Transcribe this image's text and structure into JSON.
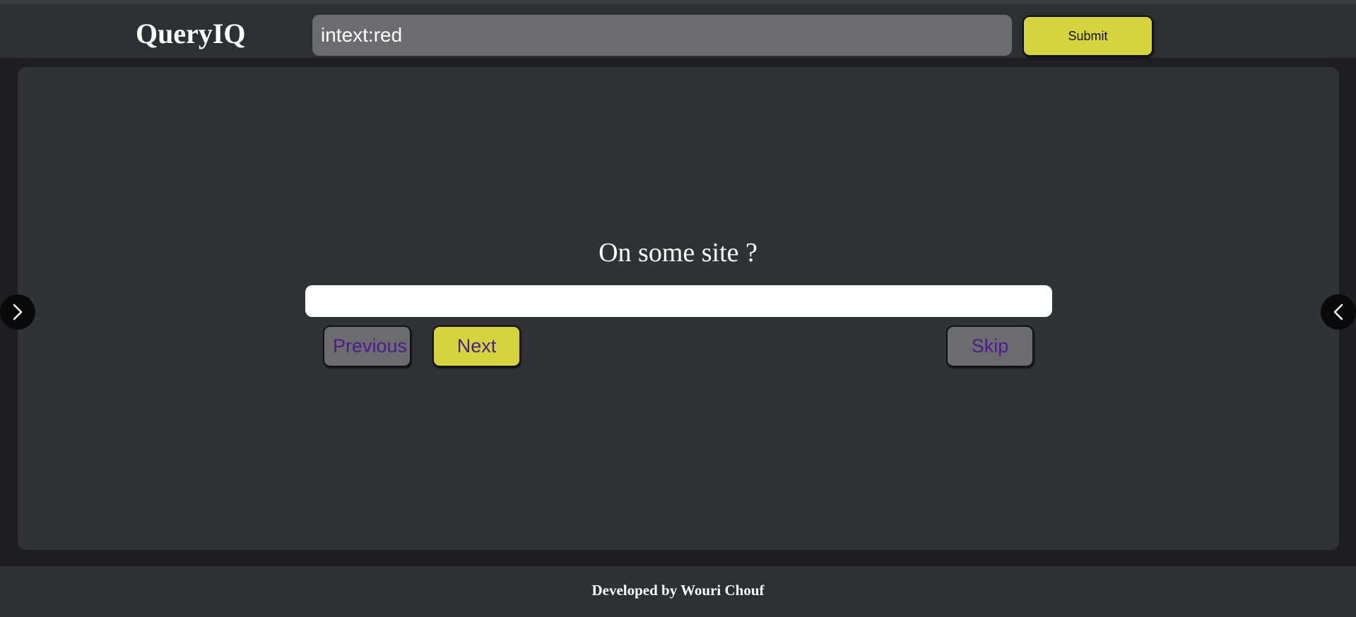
{
  "header": {
    "logo": "QueryIQ",
    "search_value": "intext:red",
    "submit_label": "Submit"
  },
  "quiz": {
    "question": "On some site ?",
    "answer_value": "",
    "previous_label": "Previous",
    "next_label": "Next",
    "skip_label": "Skip"
  },
  "side_nav": {
    "left_icon": "chevron-right-icon",
    "right_icon": "chevron-left-icon"
  },
  "footer": {
    "text": "Developed by Wouri Chouf"
  },
  "colors": {
    "accent": "#d6d43e",
    "background": "#1f1f21",
    "panel": "#313236",
    "header": "#2e2f33",
    "button_text": "#4b1d8c",
    "input_gray": "#6c6c6e"
  }
}
